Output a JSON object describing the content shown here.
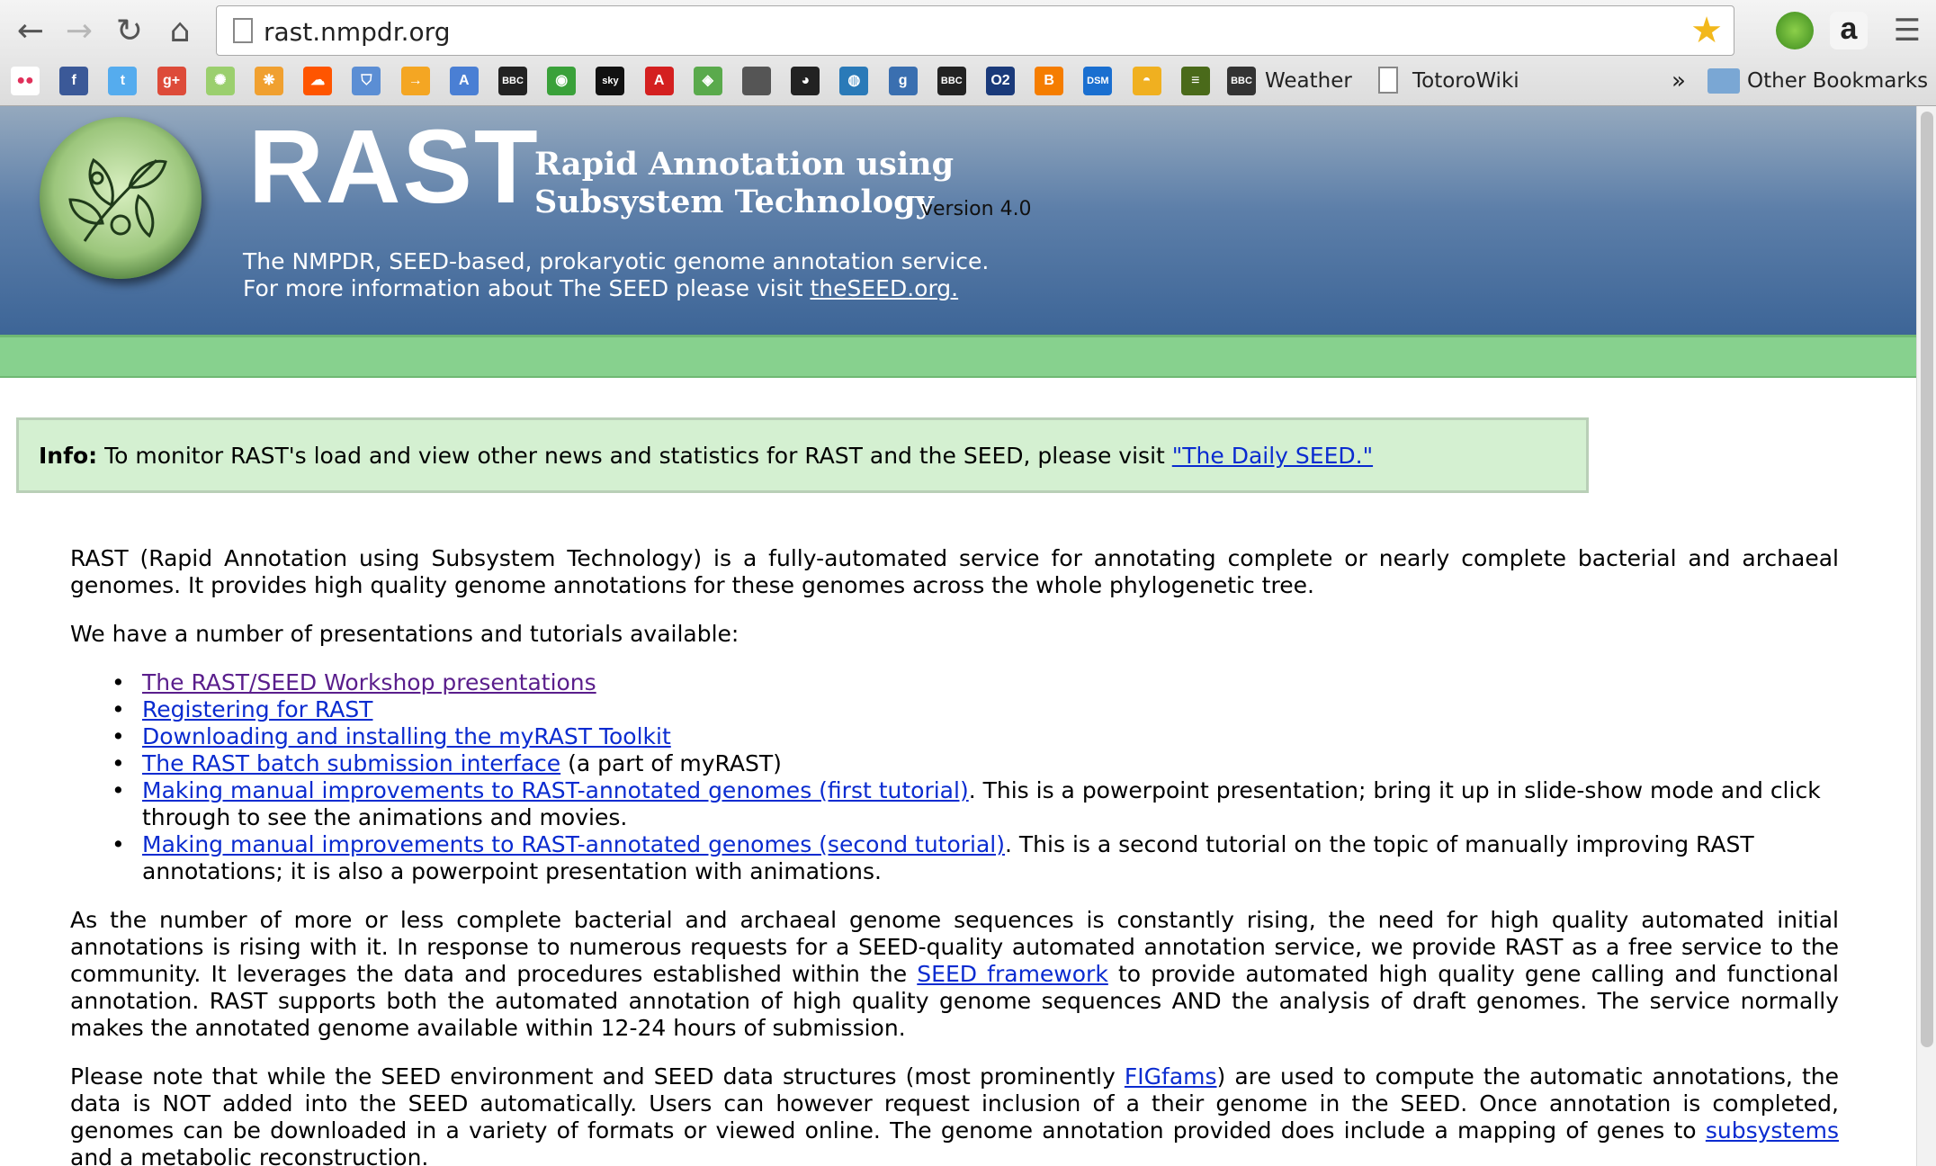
{
  "browser": {
    "url": "rast.nmpdr.org",
    "bookmarks": {
      "weather_label": "Weather",
      "totorowiki_label": "TotoroWiki",
      "overflow_label": "»",
      "other_bookmarks_label": "Other Bookmarks",
      "icons": [
        {
          "name": "flickr-icon",
          "color": "#ffffff",
          "glyph": "●●"
        },
        {
          "name": "facebook-icon",
          "color": "#3b5998",
          "glyph": "f"
        },
        {
          "name": "twitter-icon",
          "color": "#55acee",
          "glyph": "t"
        },
        {
          "name": "google-plus-icon",
          "color": "#dd4b39",
          "glyph": "g+"
        },
        {
          "name": "pinwheel-icon",
          "color": "#9bcf6e",
          "glyph": "✺"
        },
        {
          "name": "colorful-icon",
          "color": "#f0a030",
          "glyph": "❋"
        },
        {
          "name": "soundcloud-icon",
          "color": "#ff5500",
          "glyph": "☁"
        },
        {
          "name": "shield-icon",
          "color": "#5b8ed4",
          "glyph": "⛉"
        },
        {
          "name": "arrow-icon",
          "color": "#f4a623",
          "glyph": "→"
        },
        {
          "name": "translate-icon",
          "color": "#4a7fd4",
          "glyph": "A"
        },
        {
          "name": "bbc-icon",
          "color": "#222222",
          "glyph": "BBC"
        },
        {
          "name": "wifi-icon",
          "color": "#3aa13a",
          "glyph": "◉"
        },
        {
          "name": "sky-icon",
          "color": "#111111",
          "glyph": "sky"
        },
        {
          "name": "adobe-icon",
          "color": "#d42020",
          "glyph": "A"
        },
        {
          "name": "maps-icon",
          "color": "#5aaa4c",
          "glyph": "◈"
        },
        {
          "name": "apple-icon",
          "color": "#555555",
          "glyph": ""
        },
        {
          "name": "github-icon",
          "color": "#222222",
          "glyph": "◕"
        },
        {
          "name": "bucket-icon",
          "color": "#2a7ab8",
          "glyph": "◍"
        },
        {
          "name": "g-icon",
          "color": "#3a6fb0",
          "glyph": "g"
        },
        {
          "name": "bbc2-icon",
          "color": "#222222",
          "glyph": "BBC"
        },
        {
          "name": "o2-icon",
          "color": "#1a3a7a",
          "glyph": "O2"
        },
        {
          "name": "blogger-icon",
          "color": "#f57d00",
          "glyph": "B"
        },
        {
          "name": "dsm-icon",
          "color": "#1a6fd0",
          "glyph": "DSM"
        },
        {
          "name": "sunrise-icon",
          "color": "#f0b020",
          "glyph": "◓"
        },
        {
          "name": "stripes-icon",
          "color": "#4a6a1a",
          "glyph": "≡"
        },
        {
          "name": "bbc-weather-icon",
          "color": "#222222",
          "glyph": "BBC"
        }
      ]
    }
  },
  "header": {
    "title": "RAST",
    "subtitle_line1": "Rapid Annotation using",
    "subtitle_line2": "Subsystem Technology",
    "version": "version 4.0",
    "desc_line1": "The NMPDR, SEED-based, prokaryotic genome annotation service.",
    "desc_line2_prefix": "For more information about The SEED please visit ",
    "desc_line2_link": "theSEED.org."
  },
  "info": {
    "label": "Info:",
    "text": " To monitor RAST's load and view other news and statistics for RAST and the SEED, please visit ",
    "link": "\"The Daily SEED.\""
  },
  "content": {
    "intro": "RAST (Rapid Annotation using Subsystem Technology) is a fully-automated service for annotating complete or nearly complete bacterial and archaeal genomes. It provides high quality genome annotations for these genomes across the whole phylogenetic tree.",
    "tutorials_intro": "We have a number of presentations and tutorials available:",
    "tutorials": [
      {
        "link": "The RAST/SEED Workshop presentations",
        "suffix": ""
      },
      {
        "link": "Registering for RAST",
        "suffix": ""
      },
      {
        "link": "Downloading and installing the myRAST Toolkit",
        "suffix": ""
      },
      {
        "link": "The RAST batch submission interface",
        "suffix": " (a part of myRAST)"
      },
      {
        "link": "Making manual improvements to RAST-annotated genomes (first tutorial)",
        "suffix": ". This is a powerpoint presentation; bring it up in slide-show mode and click through to see the animations and movies."
      },
      {
        "link": "Making manual improvements to RAST-annotated genomes (second tutorial)",
        "suffix": ". This is a second tutorial on the topic of manually improving RAST annotations; it is also a powerpoint presentation with animations."
      }
    ],
    "para2_a": "As the number of more or less complete bacterial and archaeal genome sequences is constantly rising, the need for high quality automated initial annotations is rising with it. In response to numerous requests for a SEED-quality automated annotation service, we provide RAST as a free service to the community. It leverages the data and procedures established within the ",
    "para2_link": "SEED framework",
    "para2_b": " to provide automated high quality gene calling and functional annotation. RAST supports both the automated annotation of high quality genome sequences AND the analysis of draft genomes. The service normally makes the annotated genome available within 12-24 hours of submission.",
    "para3_a": "Please note that while the SEED environment and SEED data structures (most prominently ",
    "para3_link1": "FIGfams",
    "para3_b": ") are used to compute the automatic annotations, the data is NOT added into the SEED automatically. Users can however request inclusion of a their genome in the SEED. Once annotation is completed, genomes can be downloaded in a variety of formats or viewed online. The genome annotation provided does include a mapping of genes to ",
    "para3_link2": "subsystems",
    "para3_c": " and a metabolic reconstruction."
  }
}
